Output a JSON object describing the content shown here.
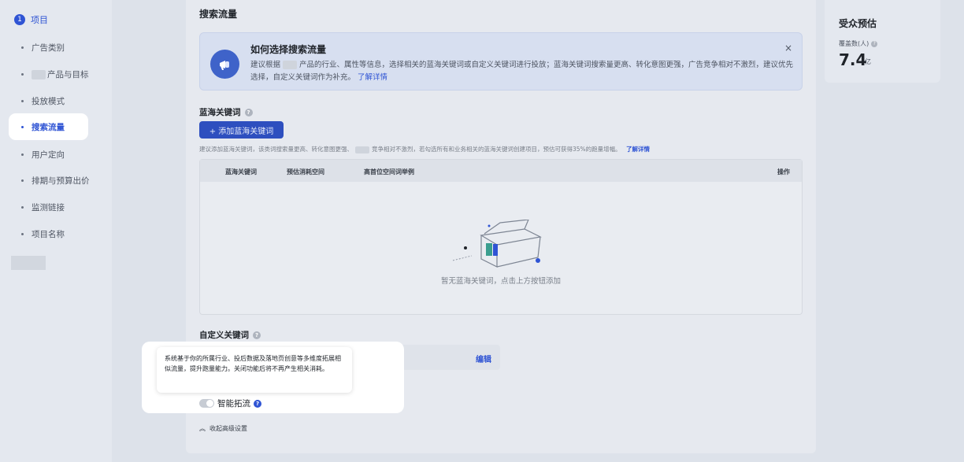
{
  "sidebar": {
    "step_number": "1",
    "step_label": "项目",
    "items": [
      {
        "label": "广告类别"
      },
      {
        "label": "产品与目标"
      },
      {
        "label": "投放模式"
      },
      {
        "label": "搜索流量",
        "active": true
      },
      {
        "label": "用户定向"
      },
      {
        "label": "排期与预算出价"
      },
      {
        "label": "监测链接"
      },
      {
        "label": "项目名称"
      }
    ]
  },
  "main": {
    "title": "搜索流量",
    "banner": {
      "title": "如何选择搜索流量",
      "text_part1": "建议根据",
      "text_part2": "产品的行业、属性等信息，选择相关的蓝海关键词或自定义关键词进行投放；蓝海关键词搜索量更高、转化意图更强，广告竞争相对不激烈，建议优先选择，自定义关键词作为补充。",
      "link": "了解详情",
      "close": "×"
    },
    "blue_ocean": {
      "title": "蓝海关键词",
      "add_button": "+ 添加蓝海关键词",
      "hint_part1": "建议添加蓝海关键词，该类词搜索量更高、转化意图更强、",
      "hint_part2": "竞争相对不激烈，若勾选所有和业务相关的蓝海关键词创建项目，预估可获得35%的跑量增幅。",
      "hint_link": "了解详情",
      "columns": [
        "蓝海关键词",
        "预估消耗空间",
        "高首位空间词举例",
        "操作"
      ],
      "empty_text": "暂无蓝海关键词，点击上方按钮添加"
    },
    "custom": {
      "title": "自定义关键词",
      "edit": "编辑"
    },
    "collapse_label": "收起高级设置"
  },
  "tooltip": {
    "text": "系统基于你的所属行业、投后数据及落地页创意等多维度拓展相似流量，提升跑量能力。关闭功能后将不再产生相关消耗。"
  },
  "smart_expand": {
    "label": "智能拓流",
    "enabled": false
  },
  "audience": {
    "title": "受众预估",
    "coverage_label": "覆盖数(人)",
    "value": "7.4",
    "unit": "亿"
  },
  "colors": {
    "primary": "#2f54d4",
    "overlay": "#dde2ea"
  }
}
